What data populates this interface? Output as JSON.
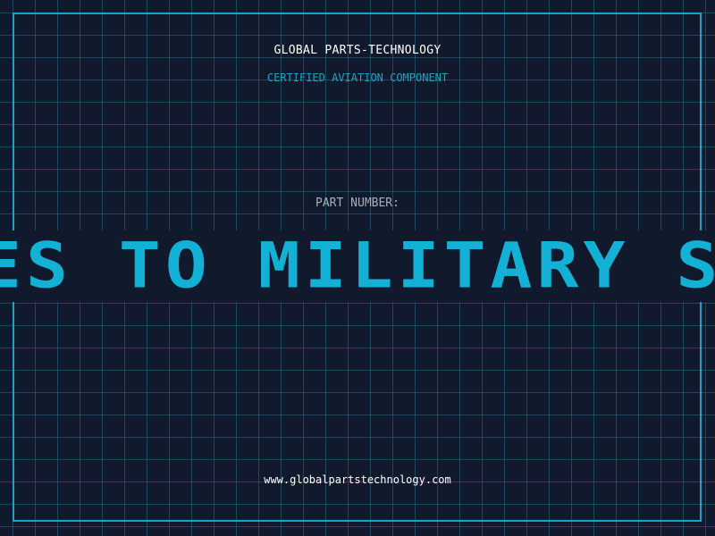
{
  "header": {
    "company": "GLOBAL PARTS-TECHNOLOGY",
    "subtitle": "CERTIFIED AVIATION COMPONENT"
  },
  "part": {
    "label": "PART NUMBER:",
    "ticker_text": "ES TO MILITARY SCHO"
  },
  "footer": {
    "website": "www.globalpartstechnology.com"
  },
  "colors": {
    "background": "#111a2c",
    "accent": "#1aa3c6",
    "grid": "#286982",
    "text_primary": "#ffffff",
    "text_muted": "#a7b0bd"
  }
}
